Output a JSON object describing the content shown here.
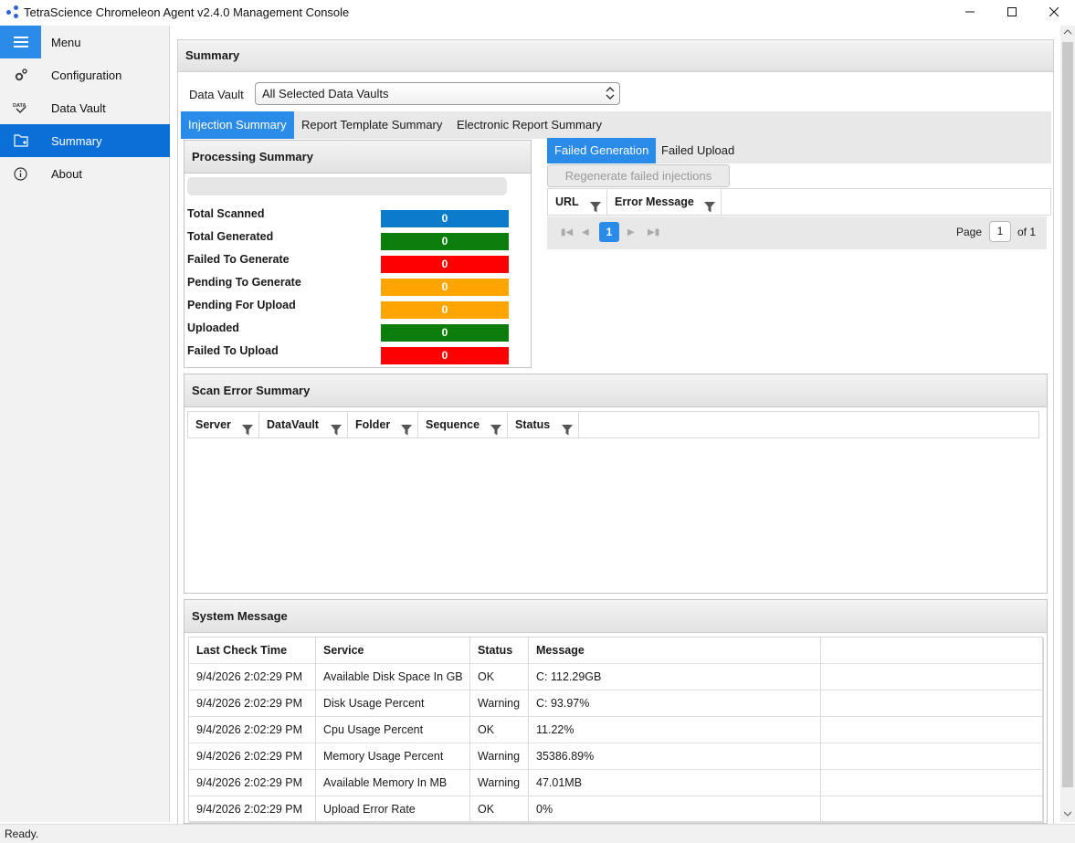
{
  "window": {
    "title": "TetraScience Chromeleon Agent v2.4.0 Management Console"
  },
  "sidebar": {
    "items": [
      {
        "label": "Menu",
        "icon": "hamburger-icon"
      },
      {
        "label": "Configuration",
        "icon": "gears-icon"
      },
      {
        "label": "Data Vault",
        "icon": "data-vault-icon"
      },
      {
        "label": "Summary",
        "icon": "summary-icon"
      },
      {
        "label": "About",
        "icon": "info-icon"
      }
    ],
    "active": "Summary"
  },
  "summary": {
    "title": "Summary",
    "data_vault_label": "Data Vault",
    "data_vault_value": "All Selected Data Vaults",
    "tabs": [
      "Injection Summary",
      "Report Template Summary",
      "Electronic Report Summary"
    ],
    "active_tab": "Injection Summary"
  },
  "processing": {
    "title": "Processing Summary",
    "stats": [
      {
        "label": "Total Scanned",
        "value": "0",
        "color": "#0b7ccc"
      },
      {
        "label": "Total Generated",
        "value": "0",
        "color": "#0a7d0a"
      },
      {
        "label": "Failed To Generate",
        "value": "0",
        "color": "#ff0000"
      },
      {
        "label": "Pending To Generate",
        "value": "0",
        "color": "#ffa500"
      },
      {
        "label": "Pending For Upload",
        "value": "0",
        "color": "#ffa500"
      },
      {
        "label": "Uploaded",
        "value": "0",
        "color": "#0a7d0a"
      },
      {
        "label": "Failed To Upload",
        "value": "0",
        "color": "#ff0000"
      }
    ]
  },
  "failed": {
    "tabs": [
      "Failed Generation",
      "Failed Upload"
    ],
    "active_tab": "Failed Generation",
    "regenerate_label": "Regenerate failed injections",
    "columns": [
      "URL",
      "Error Message"
    ],
    "pager": {
      "current_page": "1",
      "page_label": "Page",
      "page_input": "1",
      "of_label": "of 1"
    }
  },
  "scan_errors": {
    "title": "Scan Error Summary",
    "columns": [
      "Server",
      "DataVault",
      "Folder",
      "Sequence",
      "Status"
    ]
  },
  "system_message": {
    "title": "System Message",
    "columns": [
      "Last Check Time",
      "Service",
      "Status",
      "Message"
    ],
    "rows": [
      [
        "9/4/2026 2:02:29 PM",
        "Available Disk Space In GB",
        "OK",
        "C: 112.29GB"
      ],
      [
        "9/4/2026 2:02:29 PM",
        "Disk Usage Percent",
        "Warning",
        "C: 93.97%"
      ],
      [
        "9/4/2026 2:02:29 PM",
        "Cpu Usage Percent",
        "OK",
        "11.22%"
      ],
      [
        "9/4/2026 2:02:29 PM",
        "Memory Usage Percent",
        "Warning",
        "35386.89%"
      ],
      [
        "9/4/2026 2:02:29 PM",
        "Available Memory In MB",
        "Warning",
        "47.01MB"
      ],
      [
        "9/4/2026 2:02:29 PM",
        "Upload Error Rate",
        "OK",
        "0%"
      ]
    ]
  },
  "status_bar": {
    "text": "Ready."
  }
}
